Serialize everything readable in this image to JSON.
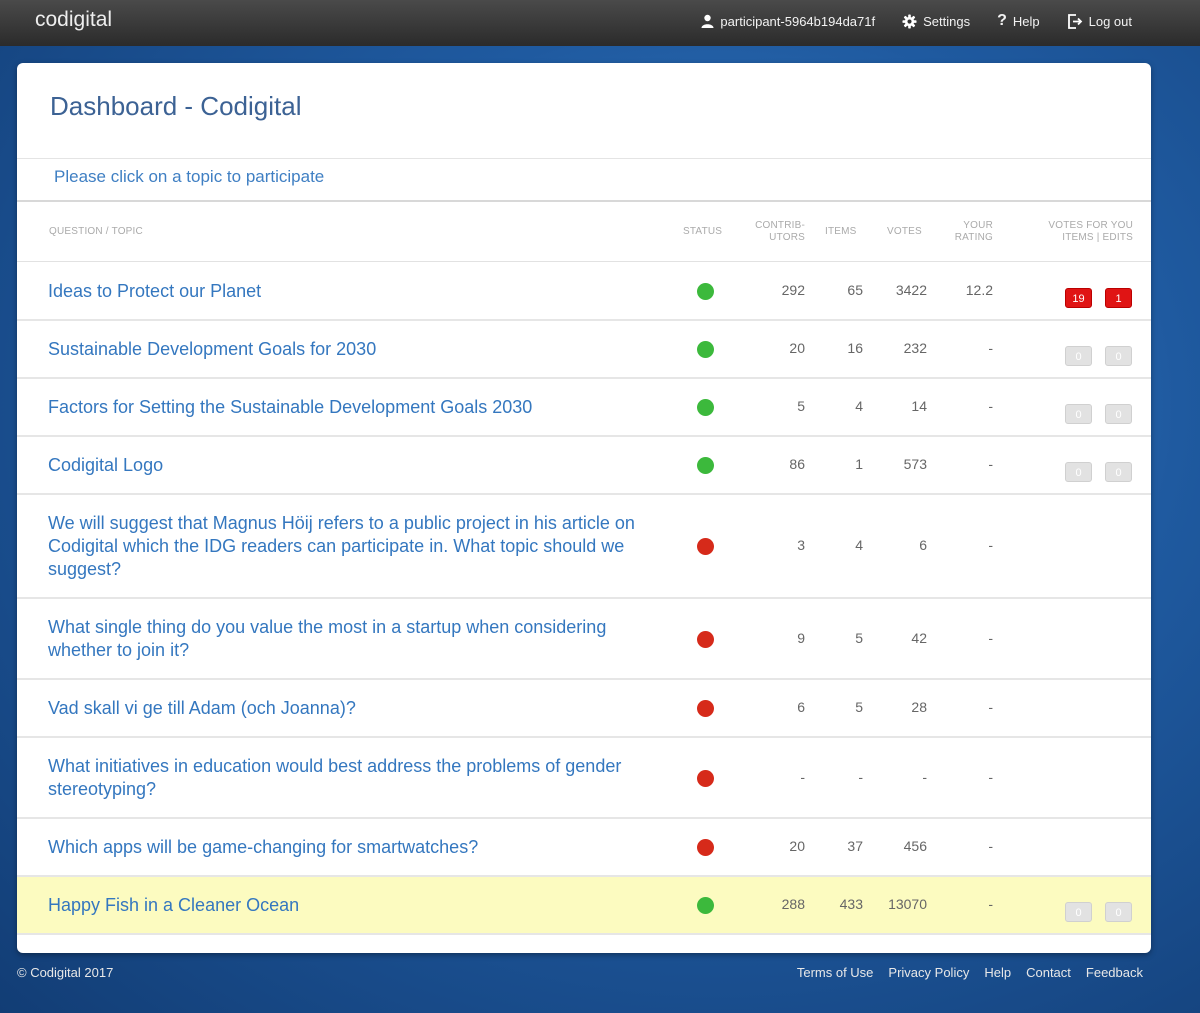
{
  "header": {
    "brand": "codigital",
    "user": "participant-5964b194da71f",
    "settings": "Settings",
    "help": "Help",
    "logout": "Log out"
  },
  "page": {
    "title": "Dashboard - Codigital",
    "hint": "Please click on a topic to participate"
  },
  "table": {
    "headers": {
      "topic": "QUESTION / TOPIC",
      "status": "STATUS",
      "contributors": "CONTRIB-\nUTORS",
      "items": "ITEMS",
      "votes": "VOTES",
      "rating": "YOUR\nRATING",
      "votes_for_you": "VOTES FOR YOU\nITEMS | EDITS"
    },
    "colors": {
      "open": "#3cb93c",
      "closed": "#d62a1a"
    },
    "rows": [
      {
        "topic": "Ideas to Protect our Planet",
        "status": "open",
        "contributors": "292",
        "items": "65",
        "votes": "3422",
        "rating": "12.2",
        "badges": {
          "type": "red",
          "items": "19",
          "edits": "1"
        }
      },
      {
        "topic": "Sustainable Development Goals for 2030",
        "status": "open",
        "contributors": "20",
        "items": "16",
        "votes": "232",
        "rating": "-",
        "badges": {
          "type": "grey",
          "items": "0",
          "edits": "0"
        }
      },
      {
        "topic": "Factors for Setting the Sustainable Development Goals 2030",
        "status": "open",
        "contributors": "5",
        "items": "4",
        "votes": "14",
        "rating": "-",
        "badges": {
          "type": "grey",
          "items": "0",
          "edits": "0"
        }
      },
      {
        "topic": "Codigital Logo",
        "status": "open",
        "contributors": "86",
        "items": "1",
        "votes": "573",
        "rating": "-",
        "badges": {
          "type": "grey",
          "items": "0",
          "edits": "0"
        }
      },
      {
        "topic": "We will suggest that Magnus Höij refers to a public project in his article on Codigital which the IDG readers can participate in. What topic should we suggest?",
        "status": "closed",
        "contributors": "3",
        "items": "4",
        "votes": "6",
        "rating": "-",
        "badges": null
      },
      {
        "topic": "What single thing do you value the most in a startup when considering whether to join it?",
        "status": "closed",
        "contributors": "9",
        "items": "5",
        "votes": "42",
        "rating": "-",
        "badges": null
      },
      {
        "topic": "Vad skall vi ge till Adam (och Joanna)?",
        "status": "closed",
        "contributors": "6",
        "items": "5",
        "votes": "28",
        "rating": "-",
        "badges": null
      },
      {
        "topic": "What initiatives in education would best address the problems of gender stereotyping?",
        "status": "closed",
        "contributors": "-",
        "items": "-",
        "votes": "-",
        "rating": "-",
        "badges": null
      },
      {
        "topic": "Which apps will be game-changing for smartwatches?",
        "status": "closed",
        "contributors": "20",
        "items": "37",
        "votes": "456",
        "rating": "-",
        "badges": null
      },
      {
        "topic": "Happy Fish in a Cleaner Ocean",
        "status": "open",
        "contributors": "288",
        "items": "433",
        "votes": "13070",
        "rating": "-",
        "badges": {
          "type": "grey",
          "items": "0",
          "edits": "0"
        },
        "highlighted": true
      }
    ]
  },
  "footer": {
    "copyright": "© Codigital 2017",
    "links": [
      "Terms of Use",
      "Privacy Policy",
      "Help",
      "Contact",
      "Feedback"
    ]
  }
}
